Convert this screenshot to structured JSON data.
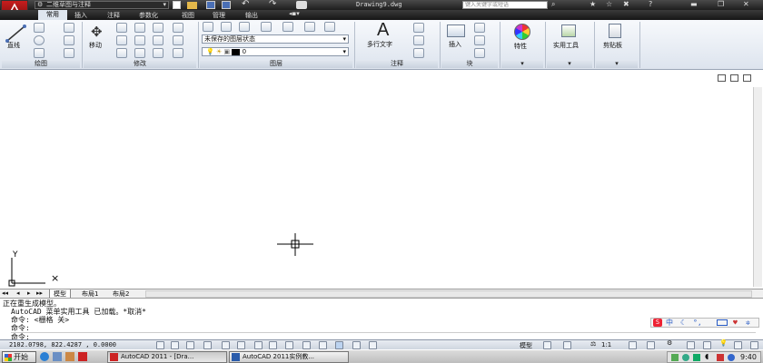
{
  "title_bar": {
    "workspace": "二维草图与注释",
    "document": "Drawing9.dwg",
    "search_placeholder": "键入关键字或短语"
  },
  "ribbon_tabs": [
    "常用",
    "插入",
    "注释",
    "参数化",
    "视图",
    "管理",
    "输出"
  ],
  "active_tab": "常用",
  "panels": {
    "draw": {
      "label": "绘图",
      "line_label": "直线"
    },
    "modify": {
      "label": "修改",
      "move_label": "移动"
    },
    "layers": {
      "label": "图层",
      "layer_state": "未保存的图层状态",
      "current_layer": "0"
    },
    "annotation": {
      "label": "注释",
      "mtext_label": "多行文字"
    },
    "block": {
      "label": "块",
      "insert_label": "插入"
    },
    "properties": {
      "label": "特性"
    },
    "utilities": {
      "label": "实用工具"
    },
    "clipboard": {
      "label": "剪贴板"
    }
  },
  "layout_tabs": [
    "模型",
    "布局1",
    "布局2"
  ],
  "command_history": [
    "正在重生成模型。",
    "AutoCAD 菜单实用工具 已加载。*取消*",
    "命令:  <栅格 关>",
    "命令:",
    "命令:"
  ],
  "ime_label": "中",
  "status_bar": {
    "coordinates": "2102.0798, 822.4287 , 0.0000",
    "model_label": "模型",
    "scale": "1:1"
  },
  "taskbar": {
    "start_label": "开始",
    "windows": [
      "AutoCAD 2011 - [Dra...",
      "AutoCAD 2011实例教..."
    ],
    "clock": "9:40"
  }
}
